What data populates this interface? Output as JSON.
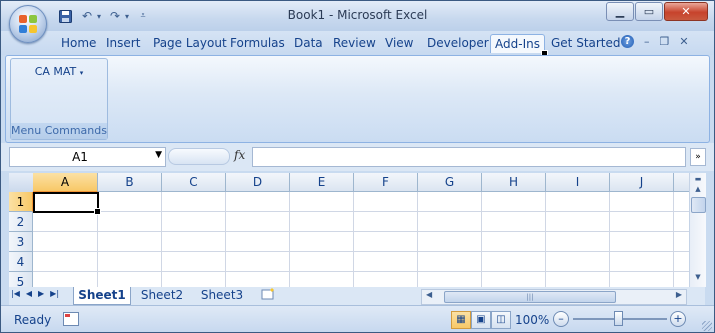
{
  "window": {
    "title": "Book1 - Microsoft Excel"
  },
  "qat": {
    "save_icon": "save-icon",
    "undo_icon": "undo-icon",
    "redo_icon": "redo-icon",
    "customize_icon": "customize-qat-icon"
  },
  "tabs": [
    "Home",
    "Insert",
    "Page Layout",
    "Formulas",
    "Data",
    "Review",
    "View",
    "Developer",
    "Add-Ins",
    "Get Started"
  ],
  "active_tab": "Add-Ins",
  "ribbon": {
    "group_button": "CA MAT",
    "group_label": "Menu Commands"
  },
  "formula_bar": {
    "name_box": "A1",
    "fx": "fx",
    "formula": ""
  },
  "columns": [
    "A",
    "B",
    "C",
    "D",
    "E",
    "F",
    "G",
    "H",
    "I",
    "J"
  ],
  "rows": [
    "1",
    "2",
    "3",
    "4",
    "5"
  ],
  "selected_cell": "A1",
  "sheets": [
    "Sheet1",
    "Sheet2",
    "Sheet3"
  ],
  "active_sheet": "Sheet1",
  "status": {
    "mode": "Ready",
    "zoom": "100%"
  },
  "colors": {
    "accent": "#15428b",
    "ribbon": "#dce8f6",
    "selection": "#f8c867",
    "close": "#c7432c"
  }
}
